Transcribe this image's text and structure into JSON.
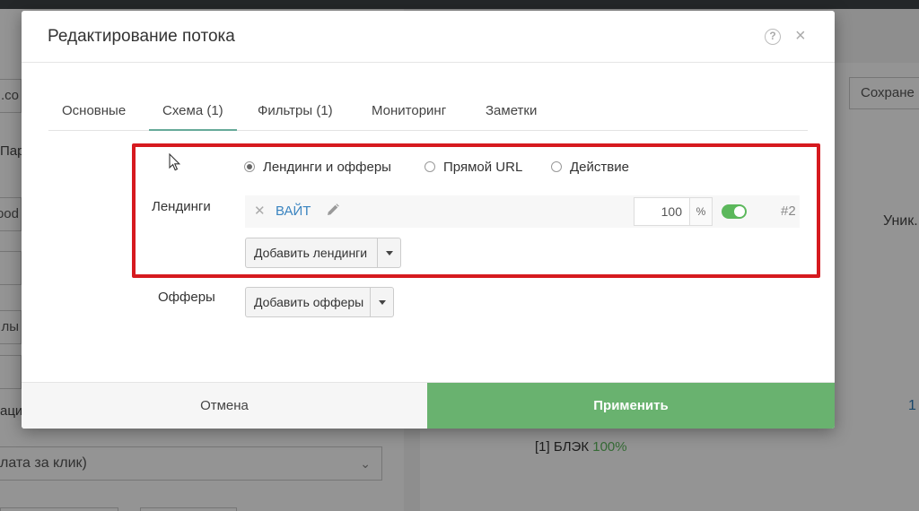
{
  "modal": {
    "title": "Редактирование потока",
    "tabs": [
      {
        "label": "Основные"
      },
      {
        "label": "Схема (1)"
      },
      {
        "label": "Фильтры (1)"
      },
      {
        "label": "Мониторинг"
      },
      {
        "label": "Заметки"
      }
    ],
    "active_tab": "Схема (1)",
    "schema_options": [
      {
        "label": "Лендинги и офферы",
        "selected": true
      },
      {
        "label": "Прямой URL",
        "selected": false
      },
      {
        "label": "Действие",
        "selected": false
      }
    ],
    "landings": {
      "label": "Лендинги",
      "items": [
        {
          "name": "ВАЙТ",
          "weight": "100",
          "unit": "%",
          "enabled": true,
          "index": "#2"
        }
      ],
      "add_label": "Добавить лендинги"
    },
    "offers": {
      "label": "Офферы",
      "add_label": "Добавить офферы"
    },
    "footer": {
      "cancel_label": "Отмена",
      "apply_label": "Применить"
    }
  },
  "background": {
    "save_button_label": "Сохране",
    "uniq_header": "Уник.",
    "row_value": "1",
    "black_label": "[1] БЛЭК",
    "black_pct": "100%",
    "select_value": "лата за клик)",
    "field_fragments": [
      "l.co",
      "Пар",
      "ood",
      "лы",
      "аци"
    ]
  },
  "colors": {
    "accent_green": "#69b26f",
    "toggle_green": "#5cb85c",
    "link_blue": "#3a84c0",
    "highlight_red": "#d61a1f"
  }
}
